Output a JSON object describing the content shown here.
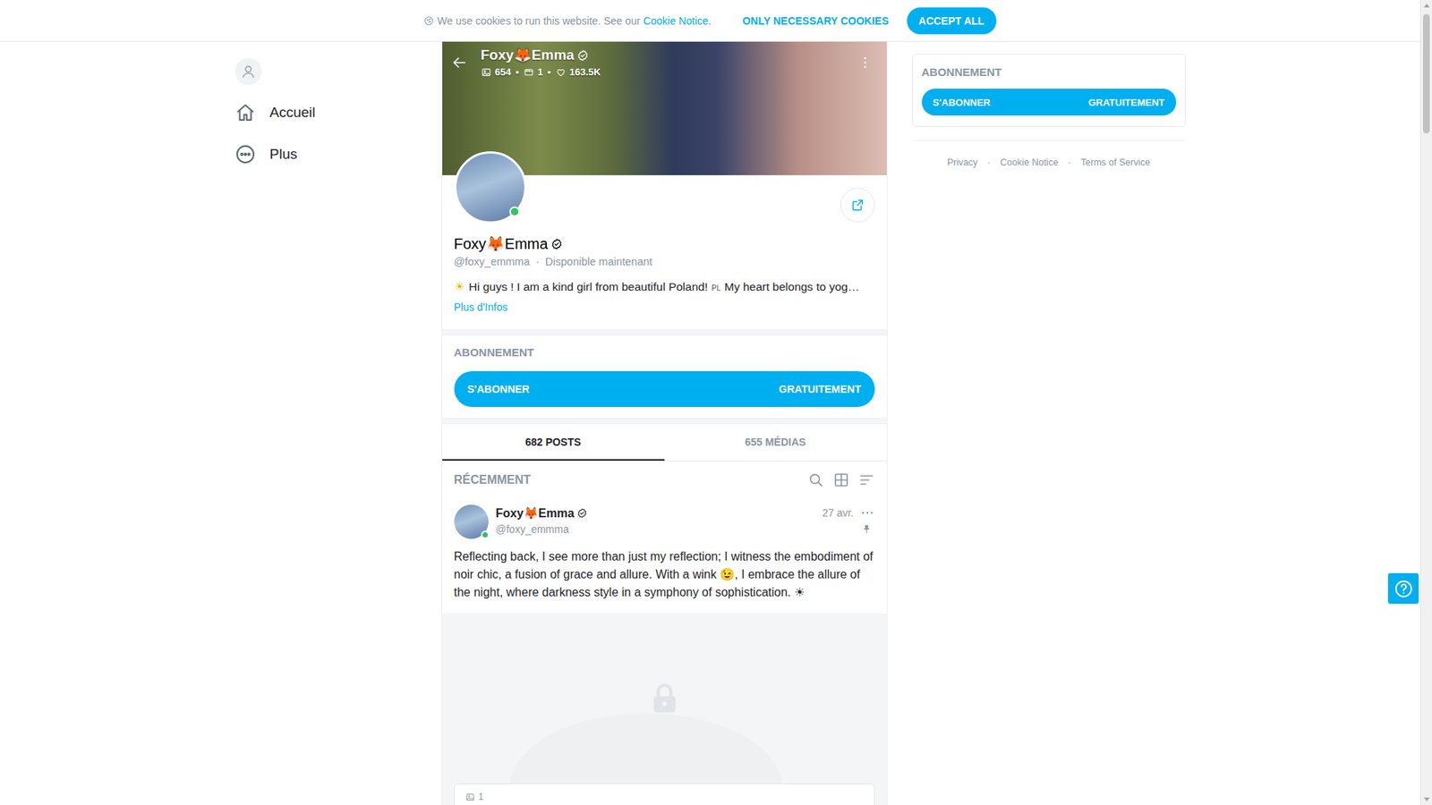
{
  "cookie_bar": {
    "text": "We use cookies to run this website. See our",
    "link": "Cookie Notice.",
    "buttons": [
      {
        "label": "ONLY NECESSARY COOKIES",
        "kind": "plain"
      },
      {
        "label": "ACCEPT ALL",
        "kind": "filled"
      }
    ]
  },
  "sidebar": {
    "items": [
      {
        "label": "Accueil",
        "kind": "home"
      },
      {
        "label": "Plus",
        "kind": "more"
      }
    ]
  },
  "header": {
    "title": "Foxy🦊Emma",
    "verified": true,
    "separator": "•",
    "stats": [
      {
        "kind": "photos",
        "value": "654"
      },
      {
        "kind": "videos",
        "value": "1"
      },
      {
        "kind": "likes",
        "value": "163.5K"
      }
    ]
  },
  "profile": {
    "name": "Foxy🦊Emma",
    "verified": true,
    "online": true,
    "handle": "@foxy_emmma",
    "separator": "·",
    "status": "Disponible maintenant",
    "bio": {
      "icon": "☀",
      "text": "Hi guys ! I am a kind girl from beautiful Poland!",
      "flag": "PL",
      "more": "My heart belongs to yog…"
    },
    "more_info": "Plus d'Infos"
  },
  "subscription": {
    "title": "ABONNEMENT",
    "button_label": "S'ABONNER",
    "price": "GRATUITEMENT"
  },
  "tabs": [
    {
      "label": "682 POSTS",
      "selected": true
    },
    {
      "label": "655 MÉDIAS",
      "selected": false
    }
  ],
  "feed": {
    "heading": "RÉCEMMENT",
    "posts": [
      {
        "name": "Foxy🦊Emma",
        "verified": true,
        "online": true,
        "handle": "@foxy_emmma",
        "date": "27 avr.",
        "pinned": true,
        "text": "Reflecting back, I see more than just my reflection; I witness the embodiment of noir chic, a fusion of grace and allure. With a wink 😉, I embrace the allure of the night, where darkness style in a symphony of sophistication. ☀",
        "locked": true,
        "media_count": "1"
      }
    ]
  },
  "right_panel": {
    "title": "ABONNEMENT",
    "button_label": "S'ABONNER",
    "price": "GRATUITEMENT",
    "footer_links": [
      "Privacy",
      "Cookie Notice",
      "Terms of Service"
    ],
    "separator": "·"
  }
}
